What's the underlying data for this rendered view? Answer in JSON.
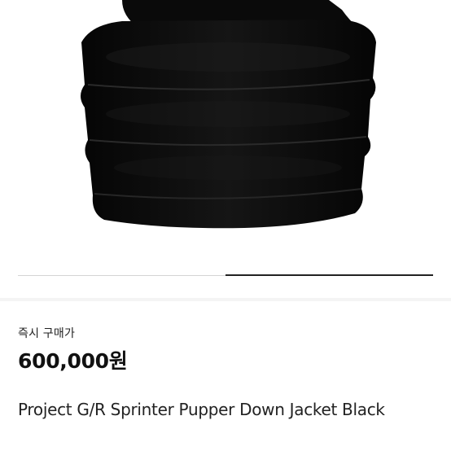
{
  "product": {
    "price_label": "즉시 구매가",
    "price": "600,000원",
    "name": "Project G/R Sprinter Pupper Down Jacket Black"
  },
  "image_carousel": {
    "current": 2,
    "total": 2
  },
  "colors": {
    "jacket": "#0b0b0b",
    "accent_text": "#222222"
  }
}
